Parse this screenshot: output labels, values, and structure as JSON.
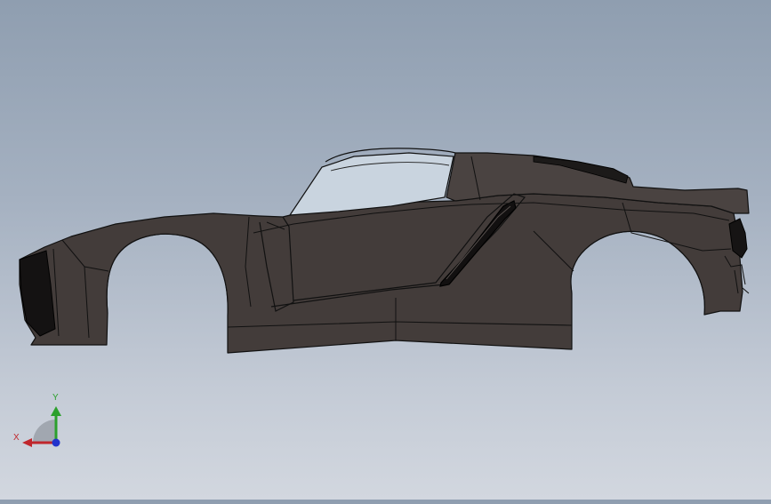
{
  "app": {
    "type": "3d-cad-viewport",
    "background_top": "#8f9eb0",
    "background_bottom": "#d2d7df"
  },
  "model": {
    "subject": "car-body-shell",
    "body_color": "#433c3a",
    "edge_color": "#111111",
    "glass_color": "#c9d4df",
    "opening_color": "#141212"
  },
  "triad": {
    "y_label": "Y",
    "x_label": "X",
    "y_color": "#2ca02c",
    "x_color": "#c0262c",
    "z_color": "#2233cc"
  }
}
